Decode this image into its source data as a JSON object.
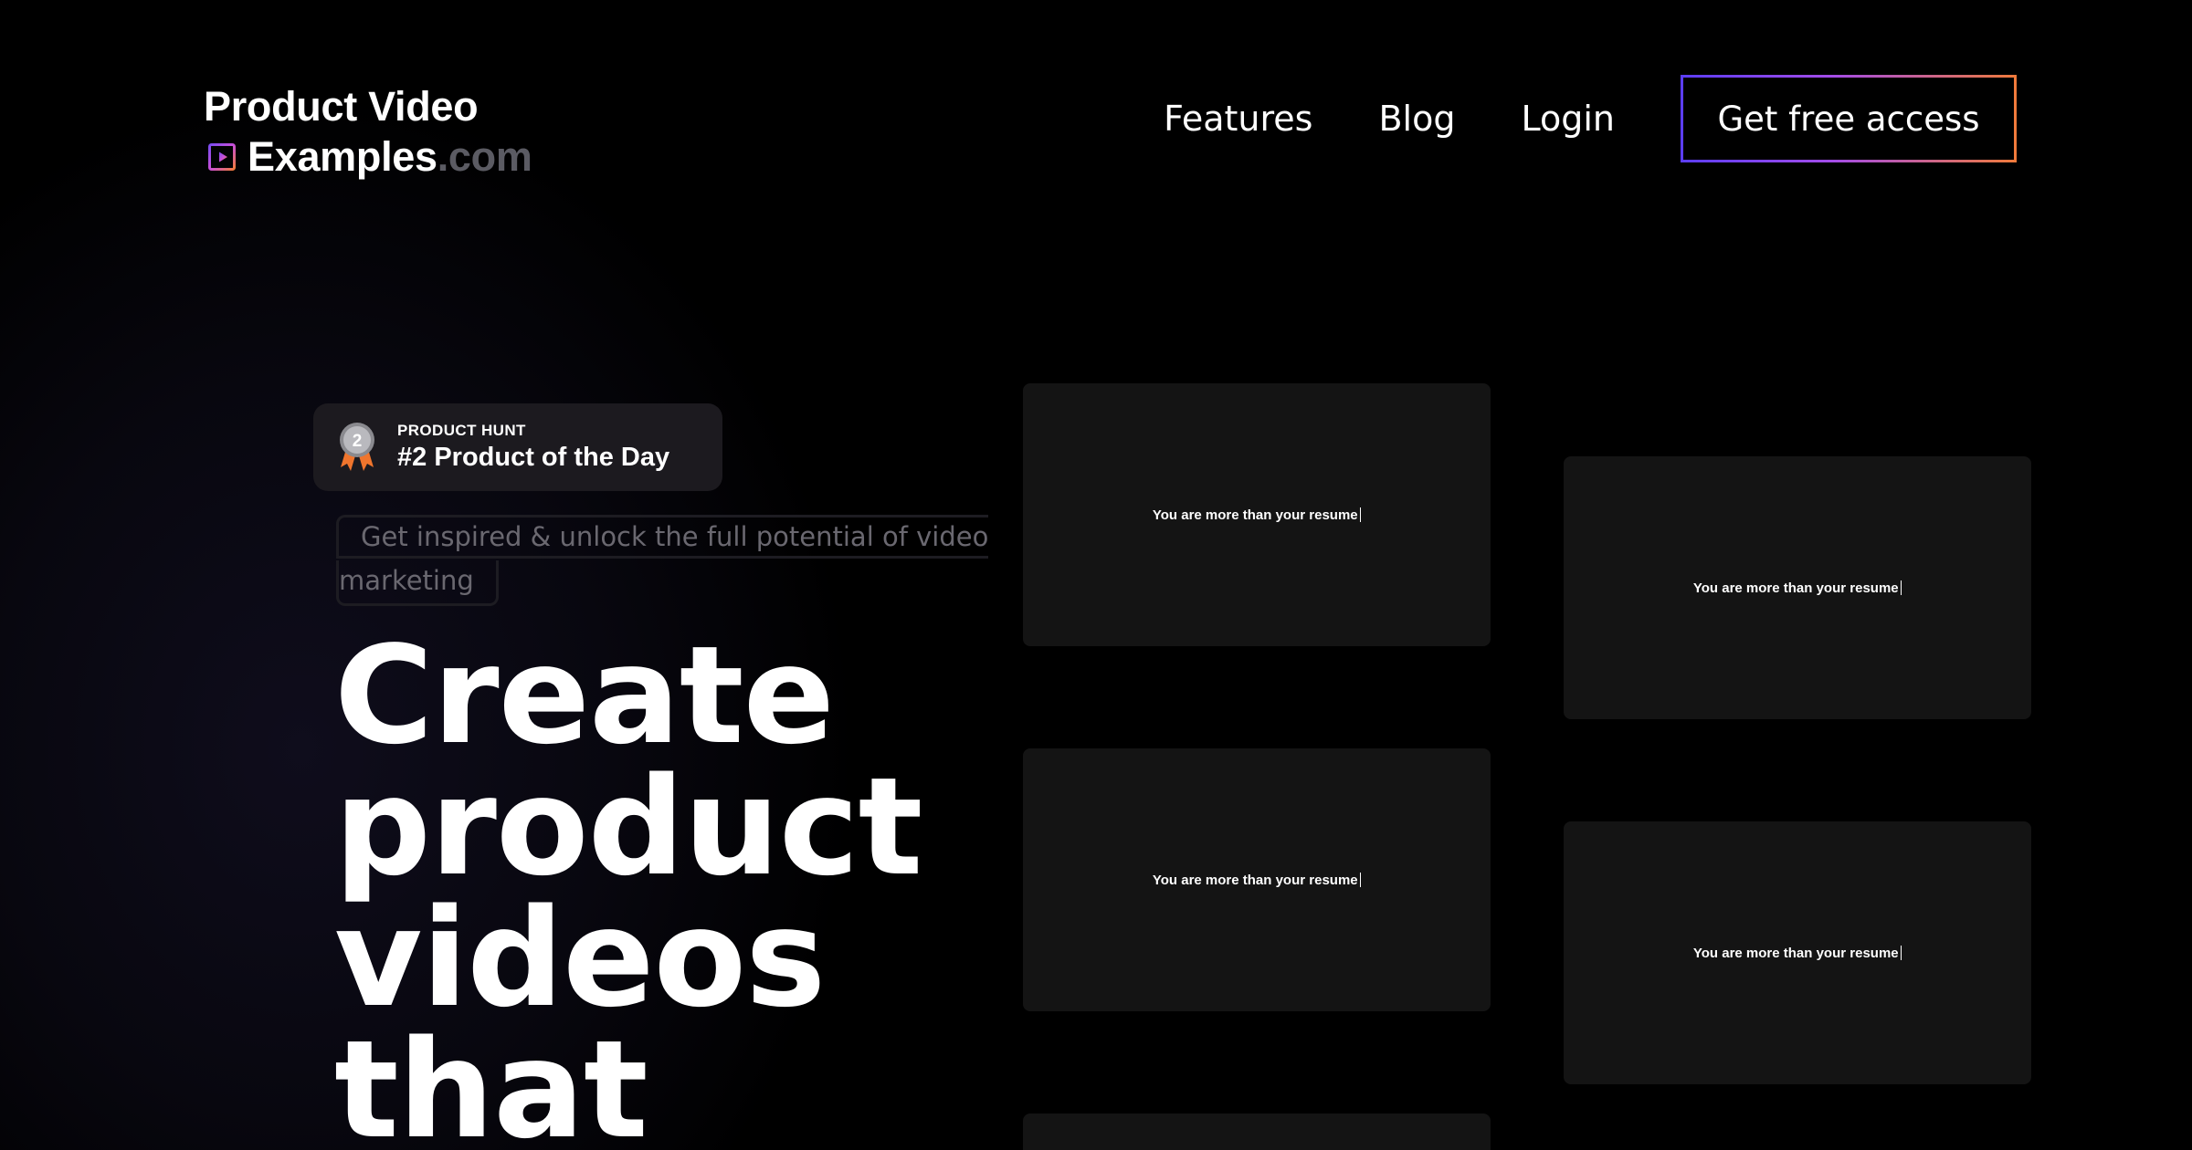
{
  "brand": {
    "line1": "Product Video",
    "line2_main": "Examples",
    "line2_suffix": ".com",
    "icon": "play-square-icon"
  },
  "nav": {
    "links": [
      "Features",
      "Blog",
      "Login"
    ],
    "cta_label": "Get free access"
  },
  "badge": {
    "kicker": "PRODUCT HUNT",
    "title": "#2 Product of the Day",
    "medal_number": "2",
    "icon": "medal-icon"
  },
  "hero": {
    "tagline_line1": "Get inspired & unlock the full potential of video",
    "tagline_line2": "marketing",
    "headline": [
      "Create",
      "product",
      "videos",
      "that"
    ]
  },
  "videos": [
    {
      "caption": "You are more than your resume"
    },
    {
      "caption": "You are more than your resume"
    },
    {
      "caption": "You are more than your resume"
    },
    {
      "caption": "You are more than your resume"
    },
    {
      "caption": ""
    }
  ],
  "colors": {
    "background": "#000000",
    "card": "#141414",
    "badge": "#1c1a1f",
    "gradient_start": "#5b3df5",
    "gradient_mid": "#a34ce8",
    "gradient_end": "#f07a3a",
    "muted_text": "#6a6870"
  }
}
